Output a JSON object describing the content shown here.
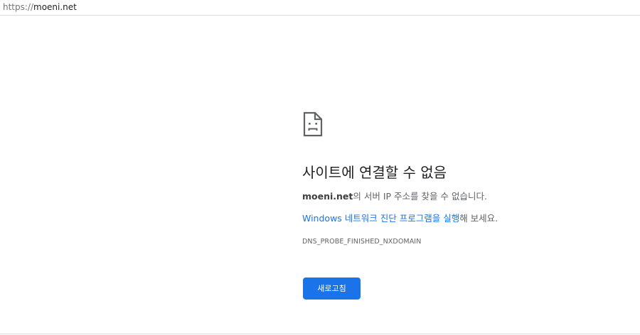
{
  "address_bar": {
    "scheme": "https://",
    "host": "moeni.net"
  },
  "error_page": {
    "icon": "sad-document-icon",
    "headline": "사이트에 연결할 수 없음",
    "host": "moeni.net",
    "dns_message_suffix": "의 서버 IP 주소를 찾을 수 없습니다.",
    "diagnostics_link": "Windows 네트워크 진단 프로그램을 실행",
    "diagnostics_suffix": "해 보세요.",
    "error_code": "DNS_PROBE_FINISHED_NXDOMAIN",
    "reload_label": "새로고침"
  },
  "colors": {
    "accent": "#1a73e8",
    "text_primary": "#202124",
    "text_secondary": "#5f6368"
  }
}
